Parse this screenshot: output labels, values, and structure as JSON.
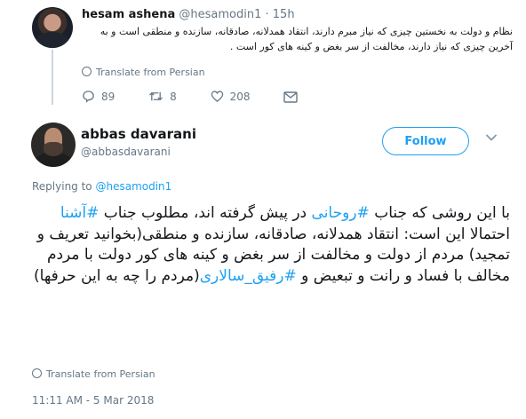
{
  "parent_tweet": {
    "name": "hesam ashena",
    "handle": "@hesamodin1 · 15h",
    "text": "نظام و دولت به نخستین چیزی که نیاز مبرم دارند، انتقاد همدلانه، صادقانه، سازنده و منطقی است و به آخرین چیزی که نیاز دارند، مخالفت از سر بغض و کینه های کور است .",
    "translate_label": "Translate from Persian",
    "replies": "89",
    "retweets": "8",
    "likes": "208"
  },
  "main_tweet": {
    "name": "abbas davarani",
    "handle": "@abbasdavarani",
    "follow_label": "Follow",
    "replying_prefix": "Replying to",
    "replying_handle": "@hesamodin1",
    "text": {
      "t1": "با این روشی که جناب ",
      "h1": "#روحانی",
      "t2": " در پیش گرفته اند، مطلوب جناب ",
      "h2": "#آشنا",
      "t3": " احتمالا این است: انتقاد همدلانه، صادقانه، سازنده و منطقی(بخوانید تعریف و تمجید) مردم از دولت و مخالفت از سر بغض و کینه های کور دولت با مردم مخالف با فساد و رانت و تبعیض و ",
      "h3": "#رفیق_سالاری",
      "t4": "(مردم را چه به این حرفها)"
    },
    "translate_label": "Translate from Persian",
    "timestamp": "11:11 AM - 5 Mar 2018"
  },
  "colors": {
    "accent": "#1da1f2",
    "muted": "#657786",
    "text": "#14171a"
  }
}
